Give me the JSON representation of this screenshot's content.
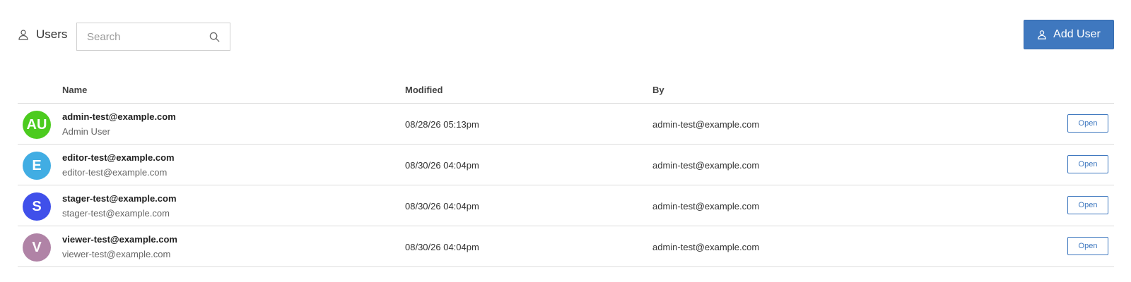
{
  "header": {
    "title": "Users",
    "search_placeholder": "Search",
    "search_value": "",
    "add_user_label": "Add User"
  },
  "table": {
    "columns": {
      "name": "Name",
      "modified": "Modified",
      "by": "By"
    },
    "rows": [
      {
        "initials": "AU",
        "avatar_color": "#4ccb1f",
        "primary": "admin-test@example.com",
        "secondary": "Admin User",
        "modified": "08/28/26 05:13pm",
        "by": "admin-test@example.com",
        "action": "Open"
      },
      {
        "initials": "E",
        "avatar_color": "#41ade3",
        "primary": "editor-test@example.com",
        "secondary": "editor-test@example.com",
        "modified": "08/30/26 04:04pm",
        "by": "admin-test@example.com",
        "action": "Open"
      },
      {
        "initials": "S",
        "avatar_color": "#4050ea",
        "primary": "stager-test@example.com",
        "secondary": "stager-test@example.com",
        "modified": "08/30/26 04:04pm",
        "by": "admin-test@example.com",
        "action": "Open"
      },
      {
        "initials": "V",
        "avatar_color": "#b083a6",
        "primary": "viewer-test@example.com",
        "secondary": "viewer-test@example.com",
        "modified": "08/30/26 04:04pm",
        "by": "admin-test@example.com",
        "action": "Open"
      }
    ]
  },
  "icons": {
    "title": "user-icon",
    "search": "search-icon",
    "add_user": "user-icon"
  },
  "colors": {
    "accent": "#3f78bf"
  }
}
